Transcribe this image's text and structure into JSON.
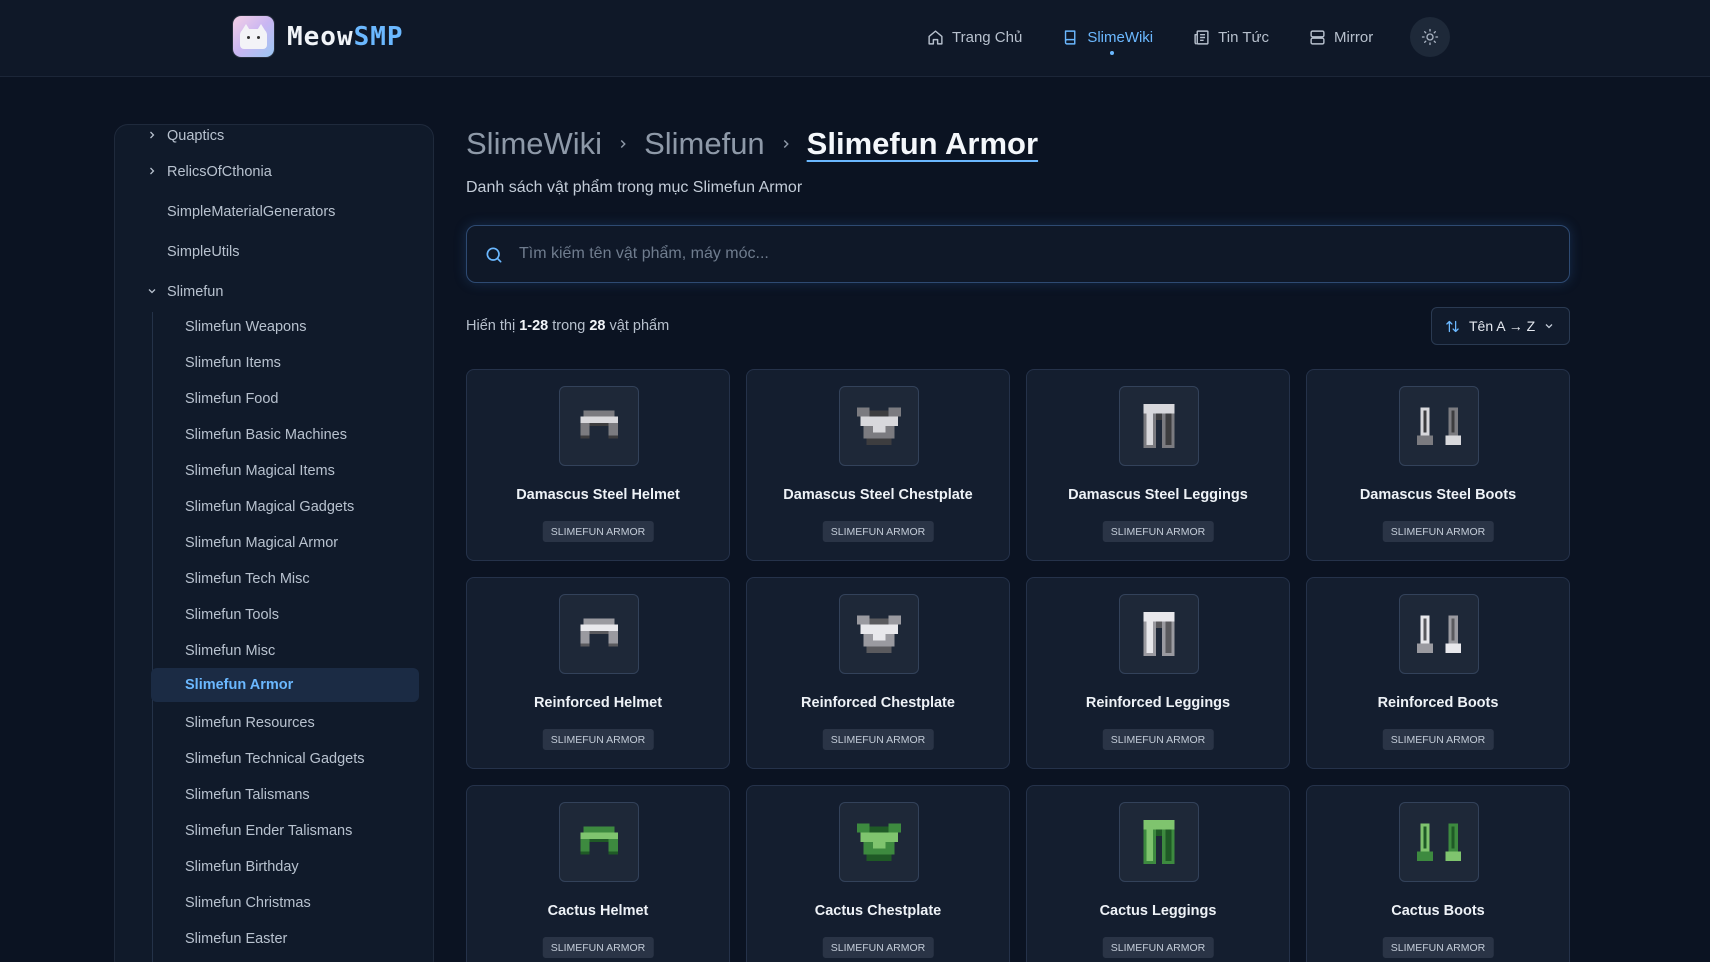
{
  "brand": {
    "name_a": "Meow",
    "name_b": "SMP"
  },
  "nav": [
    {
      "label": "Trang Chủ",
      "icon": "home-icon",
      "active": false
    },
    {
      "label": "SlimeWiki",
      "icon": "book-icon",
      "active": true
    },
    {
      "label": "Tin Tức",
      "icon": "newspaper-icon",
      "active": false
    },
    {
      "label": "Mirror",
      "icon": "server-icon",
      "active": false
    }
  ],
  "sidebar": {
    "parents": [
      {
        "label": "Quaptics",
        "expandable": true,
        "expanded": false
      },
      {
        "label": "RelicsOfCthonia",
        "expandable": true,
        "expanded": false
      },
      {
        "label": "SimpleMaterialGenerators",
        "expandable": false
      },
      {
        "label": "SimpleUtils",
        "expandable": false
      },
      {
        "label": "Slimefun",
        "expandable": true,
        "expanded": true
      }
    ],
    "children": [
      "Slimefun Weapons",
      "Slimefun Items",
      "Slimefun Food",
      "Slimefun Basic Machines",
      "Slimefun Magical Items",
      "Slimefun Magical Gadgets",
      "Slimefun Magical Armor",
      "Slimefun Tech Misc",
      "Slimefun Tools",
      "Slimefun Misc",
      "Slimefun Armor",
      "Slimefun Resources",
      "Slimefun Technical Gadgets",
      "Slimefun Talismans",
      "Slimefun Ender Talismans",
      "Slimefun Birthday",
      "Slimefun Christmas",
      "Slimefun Easter"
    ],
    "active_child": "Slimefun Armor"
  },
  "breadcrumb": [
    "SlimeWiki",
    "Slimefun",
    "Slimefun Armor"
  ],
  "subtitle": "Danh sách vật phẩm trong mục Slimefun Armor",
  "search": {
    "placeholder": "Tìm kiếm tên vật phẩm, máy móc...",
    "value": ""
  },
  "results": {
    "prefix": "Hiển thị",
    "range": "1-28",
    "middle": "trong",
    "total": "28",
    "suffix": "vật phẩm"
  },
  "sort": {
    "label": "Tên A → Z"
  },
  "colors": {
    "accent": "#6bb8ff",
    "background": "#0b1322",
    "card": "#141e2f"
  },
  "items": [
    {
      "name": "Damascus Steel Helmet",
      "tag": "SLIMEFUN ARMOR",
      "icon": "helmet-icon",
      "material": "damascus"
    },
    {
      "name": "Damascus Steel Chestplate",
      "tag": "SLIMEFUN ARMOR",
      "icon": "chestplate-icon",
      "material": "damascus"
    },
    {
      "name": "Damascus Steel Leggings",
      "tag": "SLIMEFUN ARMOR",
      "icon": "leggings-icon",
      "material": "damascus"
    },
    {
      "name": "Damascus Steel Boots",
      "tag": "SLIMEFUN ARMOR",
      "icon": "boots-icon",
      "material": "damascus"
    },
    {
      "name": "Reinforced Helmet",
      "tag": "SLIMEFUN ARMOR",
      "icon": "helmet-icon",
      "material": "reinforced"
    },
    {
      "name": "Reinforced Chestplate",
      "tag": "SLIMEFUN ARMOR",
      "icon": "chestplate-icon",
      "material": "reinforced"
    },
    {
      "name": "Reinforced Leggings",
      "tag": "SLIMEFUN ARMOR",
      "icon": "leggings-icon",
      "material": "reinforced"
    },
    {
      "name": "Reinforced Boots",
      "tag": "SLIMEFUN ARMOR",
      "icon": "boots-icon",
      "material": "reinforced"
    },
    {
      "name": "Cactus Helmet",
      "tag": "SLIMEFUN ARMOR",
      "icon": "helmet-icon",
      "material": "cactus"
    },
    {
      "name": "Cactus Chestplate",
      "tag": "SLIMEFUN ARMOR",
      "icon": "chestplate-icon",
      "material": "cactus"
    },
    {
      "name": "Cactus Leggings",
      "tag": "SLIMEFUN ARMOR",
      "icon": "leggings-icon",
      "material": "cactus"
    },
    {
      "name": "Cactus Boots",
      "tag": "SLIMEFUN ARMOR",
      "icon": "boots-icon",
      "material": "cactus"
    }
  ]
}
